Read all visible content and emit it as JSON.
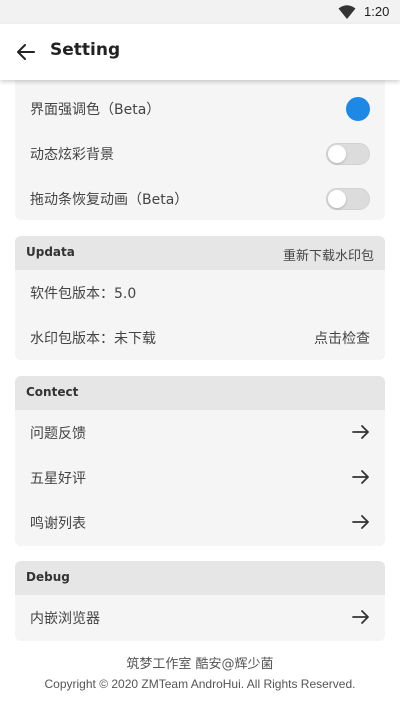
{
  "status_bar": {
    "time": "1:20",
    "wifi_icon": "wifi-icon"
  },
  "app_bar": {
    "back_icon": "arrow-left-icon",
    "title": "Setting"
  },
  "appearance": {
    "items": [
      {
        "label": "界面强调色（Beta）",
        "control": "color-dot",
        "color": "#1e88e5"
      },
      {
        "label": "动态炫彩背景",
        "control": "switch",
        "on": false
      },
      {
        "label": "拖动条恢复动画（Beta）",
        "control": "switch",
        "on": false
      }
    ]
  },
  "updata": {
    "header": "Updata",
    "action": "重新下载水印包",
    "items": [
      {
        "label": "软件包版本：5.0"
      },
      {
        "label": "水印包版本：未下载",
        "value": "点击检查"
      }
    ]
  },
  "contect": {
    "header": "Contect",
    "items": [
      {
        "label": "问题反馈"
      },
      {
        "label": "五星好评"
      },
      {
        "label": "鸣谢列表"
      }
    ]
  },
  "debug": {
    "header": "Debug",
    "items": [
      {
        "label": "内嵌浏览器"
      }
    ]
  },
  "footer": {
    "line1": "筑梦工作室 酷安@辉少菌",
    "line2": "Copyright © 2020 ZMTeam AndroHui. All Rights Reserved."
  }
}
